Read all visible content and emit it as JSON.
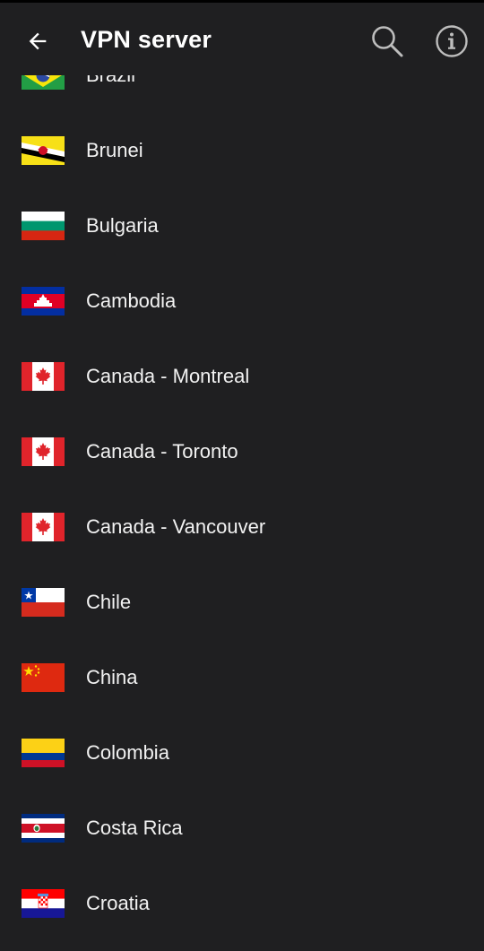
{
  "header": {
    "title": "VPN server",
    "back_icon": "back-arrow-icon",
    "search_icon": "search-icon",
    "info_icon": "info-icon"
  },
  "servers": [
    {
      "name": "Brazil",
      "flag": "brazil"
    },
    {
      "name": "Brunei",
      "flag": "brunei"
    },
    {
      "name": "Bulgaria",
      "flag": "bulgaria"
    },
    {
      "name": "Cambodia",
      "flag": "cambodia"
    },
    {
      "name": "Canada - Montreal",
      "flag": "canada"
    },
    {
      "name": "Canada - Toronto",
      "flag": "canada"
    },
    {
      "name": "Canada - Vancouver",
      "flag": "canada"
    },
    {
      "name": "Chile",
      "flag": "chile"
    },
    {
      "name": "China",
      "flag": "china"
    },
    {
      "name": "Colombia",
      "flag": "colombia"
    },
    {
      "name": "Costa Rica",
      "flag": "costa-rica"
    },
    {
      "name": "Croatia",
      "flag": "croatia"
    }
  ]
}
